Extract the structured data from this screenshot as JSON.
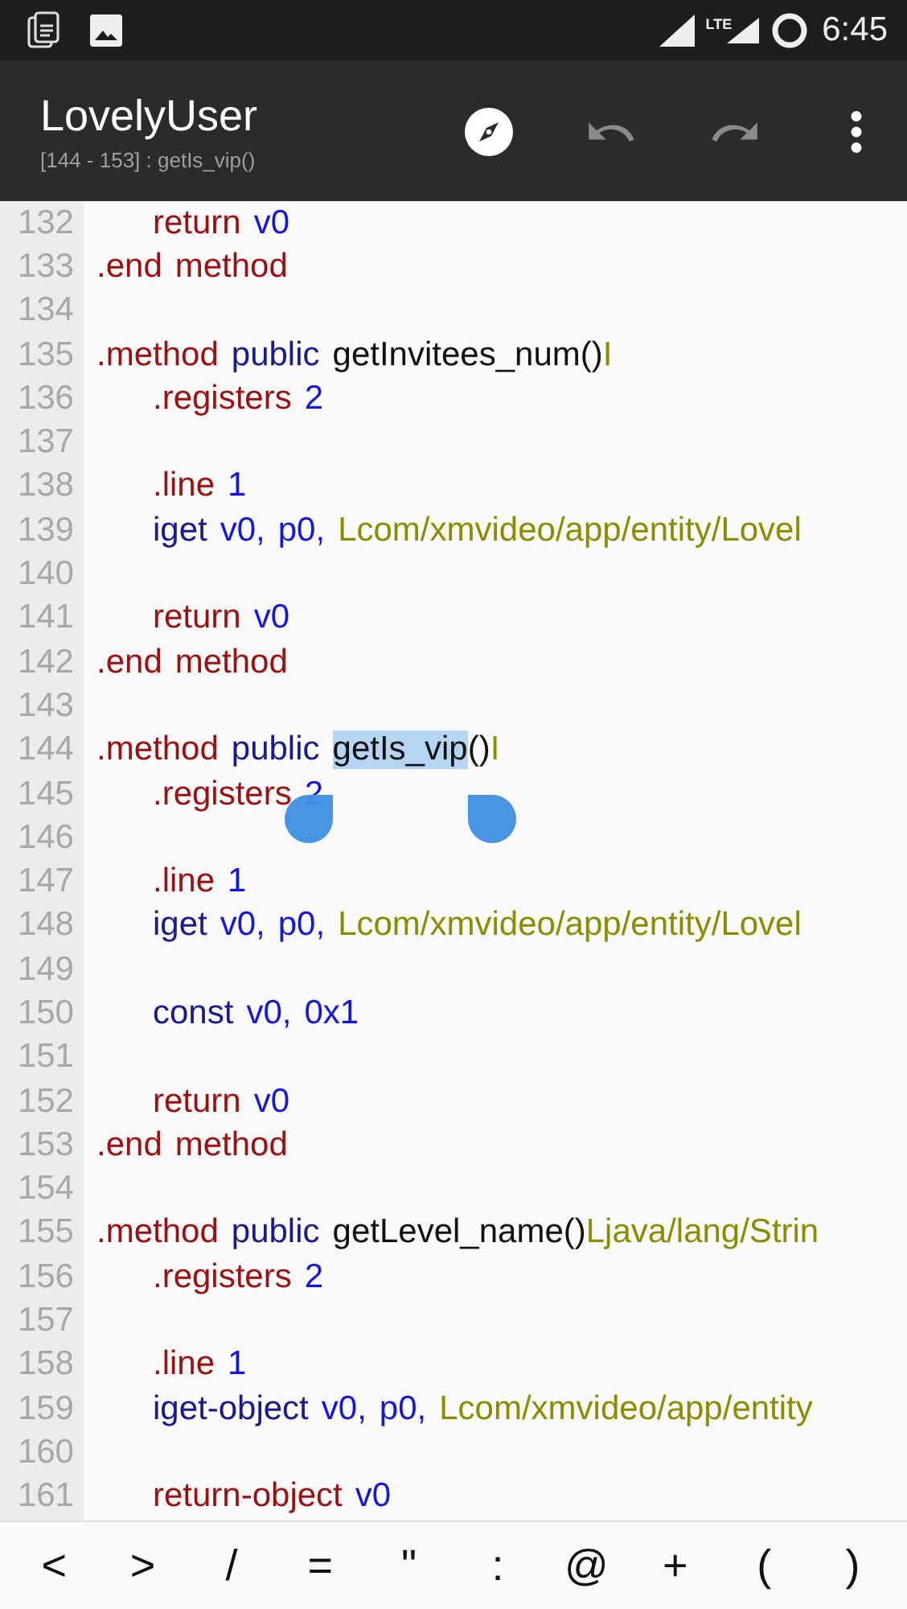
{
  "status_bar": {
    "network": "LTE",
    "time": "6:45"
  },
  "toolbar": {
    "title": "LovelyUser",
    "subtitle": "[144 - 153] : getIs_vip()",
    "actions": [
      {
        "kind": "navigate",
        "disabled": false
      },
      {
        "kind": "undo",
        "disabled": true
      },
      {
        "kind": "redo",
        "disabled": true
      },
      {
        "kind": "more",
        "disabled": false
      }
    ]
  },
  "editor": {
    "lines": [
      {
        "number": "132",
        "indent": true,
        "tokens": [
          {
            "kind": "directive",
            "text": "return"
          },
          {
            "kind": "register",
            "text": "v0"
          }
        ]
      },
      {
        "number": "133",
        "indent": false,
        "tokens": [
          {
            "kind": "directive",
            "text": ".end"
          },
          {
            "kind": "directive",
            "text": "method"
          }
        ]
      },
      {
        "number": "134",
        "indent": false
      },
      {
        "number": "135",
        "indent": false,
        "tokens": [
          {
            "kind": "directive",
            "text": ".method"
          },
          {
            "kind": "keyword",
            "text": "public"
          },
          {
            "kind": "name",
            "text": "getInvitees_num()"
          },
          {
            "kind": "type",
            "text": "I",
            "attach": true
          }
        ]
      },
      {
        "number": "136",
        "indent": true,
        "tokens": [
          {
            "kind": "directive",
            "text": ".registers"
          },
          {
            "kind": "register",
            "text": "2"
          }
        ]
      },
      {
        "number": "137",
        "indent": false
      },
      {
        "number": "138",
        "indent": true,
        "tokens": [
          {
            "kind": "directive",
            "text": ".line"
          },
          {
            "kind": "register",
            "text": "1"
          }
        ]
      },
      {
        "number": "139",
        "indent": true,
        "tokens": [
          {
            "kind": "keyword",
            "text": "iget"
          },
          {
            "kind": "register",
            "text": "v0,"
          },
          {
            "kind": "register",
            "text": "p0,"
          },
          {
            "kind": "type",
            "text": "Lcom/xmvideo/app/entity/Lovel"
          }
        ]
      },
      {
        "number": "140",
        "indent": false
      },
      {
        "number": "141",
        "indent": true,
        "tokens": [
          {
            "kind": "directive",
            "text": "return"
          },
          {
            "kind": "register",
            "text": "v0"
          }
        ]
      },
      {
        "number": "142",
        "indent": false,
        "tokens": [
          {
            "kind": "directive",
            "text": ".end"
          },
          {
            "kind": "directive",
            "text": "method"
          }
        ]
      },
      {
        "number": "143",
        "indent": false
      },
      {
        "number": "144",
        "indent": false,
        "tokens": [
          {
            "kind": "directive",
            "text": ".method"
          },
          {
            "kind": "keyword",
            "text": "public"
          },
          {
            "kind": "name",
            "text": "getIs_vip",
            "selected": true
          },
          {
            "kind": "name",
            "text": "()",
            "attach": true
          },
          {
            "kind": "type",
            "text": "I",
            "attach": true
          }
        ]
      },
      {
        "number": "145",
        "indent": true,
        "tokens": [
          {
            "kind": "directive",
            "text": ".registers"
          },
          {
            "kind": "register",
            "text": "2"
          }
        ]
      },
      {
        "number": "146",
        "indent": false
      },
      {
        "number": "147",
        "indent": true,
        "tokens": [
          {
            "kind": "directive",
            "text": ".line"
          },
          {
            "kind": "register",
            "text": "1"
          }
        ]
      },
      {
        "number": "148",
        "indent": true,
        "tokens": [
          {
            "kind": "keyword",
            "text": "iget"
          },
          {
            "kind": "register",
            "text": "v0,"
          },
          {
            "kind": "register",
            "text": "p0,"
          },
          {
            "kind": "type",
            "text": "Lcom/xmvideo/app/entity/Lovel"
          }
        ]
      },
      {
        "number": "149",
        "indent": false
      },
      {
        "number": "150",
        "indent": true,
        "tokens": [
          {
            "kind": "keyword",
            "text": "const"
          },
          {
            "kind": "register",
            "text": "v0,"
          },
          {
            "kind": "register",
            "text": "0x1"
          }
        ]
      },
      {
        "number": "151",
        "indent": false
      },
      {
        "number": "152",
        "indent": true,
        "tokens": [
          {
            "kind": "directive",
            "text": "return"
          },
          {
            "kind": "register",
            "text": "v0"
          }
        ]
      },
      {
        "number": "153",
        "indent": false,
        "tokens": [
          {
            "kind": "directive",
            "text": ".end"
          },
          {
            "kind": "directive",
            "text": "method"
          }
        ]
      },
      {
        "number": "154",
        "indent": false
      },
      {
        "number": "155",
        "indent": false,
        "tokens": [
          {
            "kind": "directive",
            "text": ".method"
          },
          {
            "kind": "keyword",
            "text": "public"
          },
          {
            "kind": "name",
            "text": "getLevel_name()"
          },
          {
            "kind": "type",
            "text": "Ljava/lang/Strin",
            "attach": true
          }
        ]
      },
      {
        "number": "156",
        "indent": true,
        "tokens": [
          {
            "kind": "directive",
            "text": ".registers"
          },
          {
            "kind": "register",
            "text": "2"
          }
        ]
      },
      {
        "number": "157",
        "indent": false
      },
      {
        "number": "158",
        "indent": true,
        "tokens": [
          {
            "kind": "directive",
            "text": ".line"
          },
          {
            "kind": "register",
            "text": "1"
          }
        ]
      },
      {
        "number": "159",
        "indent": true,
        "tokens": [
          {
            "kind": "keyword",
            "text": "iget-object"
          },
          {
            "kind": "register",
            "text": "v0,"
          },
          {
            "kind": "register",
            "text": "p0,"
          },
          {
            "kind": "type",
            "text": "Lcom/xmvideo/app/entity"
          }
        ]
      },
      {
        "number": "160",
        "indent": false
      },
      {
        "number": "161",
        "indent": true,
        "tokens": [
          {
            "kind": "directive",
            "text": "return-object"
          },
          {
            "kind": "register",
            "text": "v0"
          }
        ]
      }
    ]
  },
  "symbol_keys": [
    "<",
    ">",
    "/",
    "=",
    "\"",
    ":",
    "@",
    "+",
    "(",
    ")"
  ]
}
